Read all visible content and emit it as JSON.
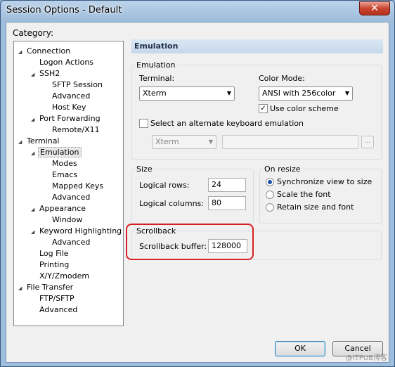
{
  "window": {
    "title": "Session Options - Default",
    "close_glyph": "✕"
  },
  "category": {
    "label": "Category:",
    "tree": [
      {
        "label": "Connection",
        "level": 0,
        "expanded": true
      },
      {
        "label": "Logon Actions",
        "level": 1,
        "expanded": null
      },
      {
        "label": "SSH2",
        "level": 1,
        "expanded": true
      },
      {
        "label": "SFTP Session",
        "level": 2,
        "expanded": null
      },
      {
        "label": "Advanced",
        "level": 2,
        "expanded": null
      },
      {
        "label": "Host Key",
        "level": 2,
        "expanded": null
      },
      {
        "label": "Port Forwarding",
        "level": 1,
        "expanded": true
      },
      {
        "label": "Remote/X11",
        "level": 2,
        "expanded": null
      },
      {
        "label": "Terminal",
        "level": 0,
        "expanded": true
      },
      {
        "label": "Emulation",
        "level": 1,
        "expanded": true,
        "selected": true
      },
      {
        "label": "Modes",
        "level": 2,
        "expanded": null
      },
      {
        "label": "Emacs",
        "level": 2,
        "expanded": null
      },
      {
        "label": "Mapped Keys",
        "level": 2,
        "expanded": null
      },
      {
        "label": "Advanced",
        "level": 2,
        "expanded": null
      },
      {
        "label": "Appearance",
        "level": 1,
        "expanded": true
      },
      {
        "label": "Window",
        "level": 2,
        "expanded": null
      },
      {
        "label": "Keyword Highlighting",
        "level": 1,
        "expanded": true
      },
      {
        "label": "Advanced",
        "level": 2,
        "expanded": null
      },
      {
        "label": "Log File",
        "level": 1,
        "expanded": null
      },
      {
        "label": "Printing",
        "level": 1,
        "expanded": null
      },
      {
        "label": "X/Y/Zmodem",
        "level": 1,
        "expanded": null
      },
      {
        "label": "File Transfer",
        "level": 0,
        "expanded": true
      },
      {
        "label": "FTP/SFTP",
        "level": 1,
        "expanded": null
      },
      {
        "label": "Advanced",
        "level": 1,
        "expanded": null
      }
    ]
  },
  "panel": {
    "header": "Emulation",
    "emulation": {
      "title": "Emulation",
      "terminal_label": "Terminal:",
      "terminal_value": "Xterm",
      "color_mode_label": "Color Mode:",
      "color_mode_value": "ANSI with 256color",
      "use_color_scheme_label": "Use color scheme",
      "use_color_scheme_checked": true,
      "alt_keyboard_label": "Select an alternate keyboard emulation",
      "alt_keyboard_checked": false,
      "alt_keyboard_value": "Xterm",
      "browse_label": "..."
    },
    "size": {
      "title": "Size",
      "rows_label": "Logical rows:",
      "rows_value": "24",
      "columns_label": "Logical columns:",
      "columns_value": "80"
    },
    "on_resize": {
      "title": "On resize",
      "options": [
        {
          "label": "Synchronize view to size",
          "selected": true
        },
        {
          "label": "Scale the font",
          "selected": false
        },
        {
          "label": "Retain size and font",
          "selected": false
        }
      ]
    },
    "scrollback": {
      "title": "Scrollback",
      "buffer_label": "Scrollback buffer:",
      "buffer_value": "128000"
    }
  },
  "buttons": {
    "ok": "OK",
    "cancel": "Cancel"
  },
  "watermark": "@ITPUB博客",
  "colors": {
    "highlight": "#d82020",
    "selection_radio": "#1c4ea8"
  }
}
